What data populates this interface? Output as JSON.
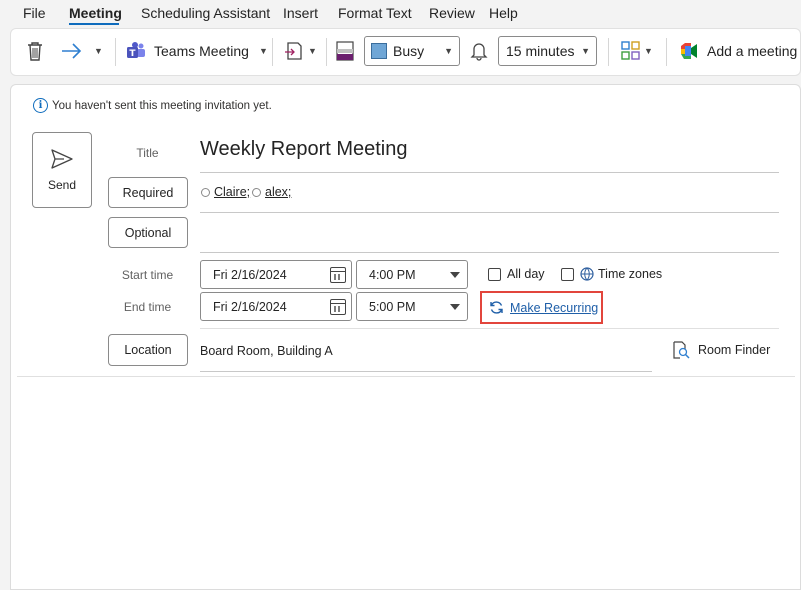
{
  "menu": {
    "items": [
      "File",
      "Meeting",
      "Scheduling Assistant",
      "Insert",
      "Format Text",
      "Review",
      "Help"
    ],
    "active": "Meeting"
  },
  "ribbon": {
    "teams_label": "Teams Meeting",
    "show_as": "Busy",
    "reminder": "15 minutes",
    "add_meeting_label": "Add a meeting",
    "show_as_color": "#6fa6d6"
  },
  "notice": "You haven't sent this meeting invitation yet.",
  "send_label": "Send",
  "form": {
    "title_label": "Title",
    "title_value": "Weekly Report Meeting",
    "required_label": "Required",
    "optional_label": "Optional",
    "attendees": [
      "Claire;",
      "alex;"
    ],
    "start_label": "Start time",
    "end_label": "End time",
    "start_date": "Fri 2/16/2024",
    "start_time": "4:00 PM",
    "end_date": "Fri 2/16/2024",
    "end_time": "5:00 PM",
    "all_day_label": "All day",
    "time_zones_label": "Time zones",
    "make_recurring_label": "Make Recurring",
    "location_label": "Location",
    "location_value": "Board Room, Building A",
    "room_finder_label": "Room Finder"
  },
  "colors": {
    "accent": "#0f6cbd",
    "highlight_border": "#e2453c",
    "link": "#1f5fa8"
  }
}
